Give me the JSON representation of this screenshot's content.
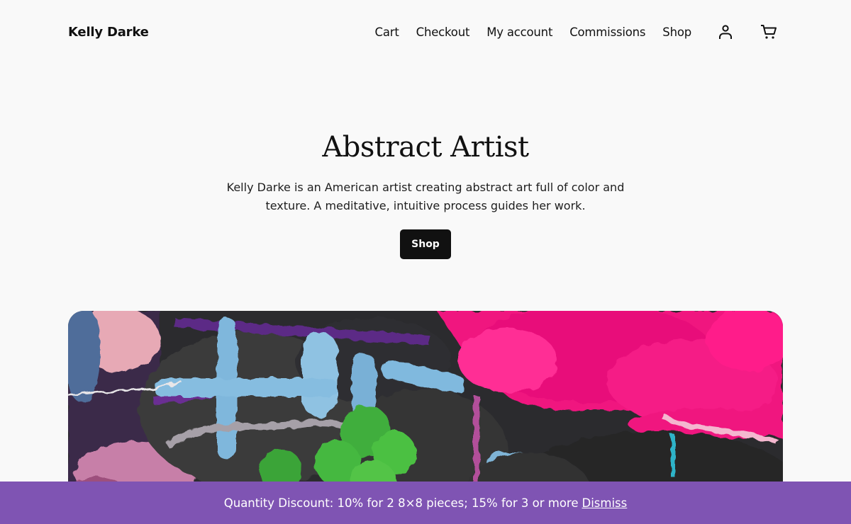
{
  "header": {
    "site_title": "Kelly Darke",
    "nav": [
      {
        "label": "Cart"
      },
      {
        "label": "Checkout"
      },
      {
        "label": "My account"
      },
      {
        "label": "Commissions"
      },
      {
        "label": "Shop"
      }
    ],
    "icons": {
      "account": "account-icon",
      "cart": "cart-icon"
    }
  },
  "hero": {
    "title": "Abstract Artist",
    "description": "Kelly Darke is an American artist creating abstract art full of color and texture. A meditative, intuitive process guides her work.",
    "button_label": "Shop"
  },
  "notice": {
    "text": "Quantity Discount: 10% for 2 8×8 pieces; 15% for 3 or more",
    "dismiss_label": "Dismiss",
    "background": "#7f54b3"
  },
  "colors": {
    "page_background": "#f9f9f9",
    "button_background": "#111111"
  }
}
